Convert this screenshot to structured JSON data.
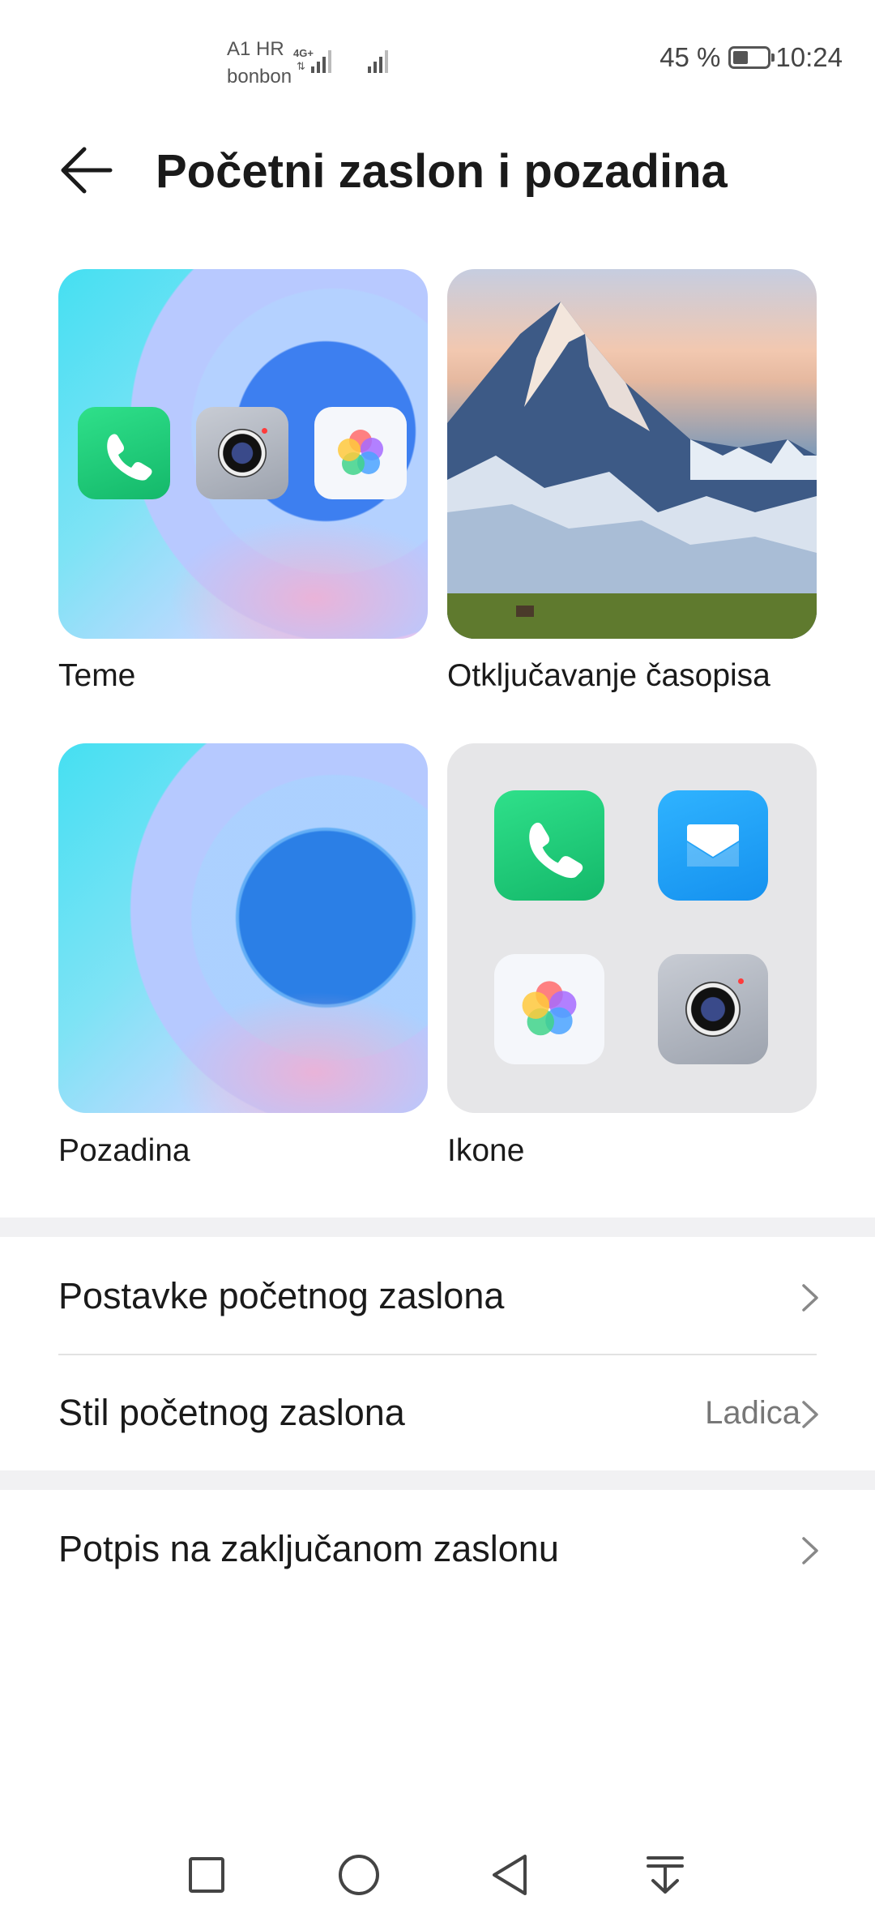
{
  "status_bar": {
    "carrier_line1": "A1 HR",
    "carrier_line2": "bonbon",
    "network": "4G+",
    "battery_percent": "45 %",
    "battery_level": 0.45,
    "time": "10:24"
  },
  "header": {
    "title": "Početni zaslon i pozadina"
  },
  "cards": {
    "themes_label": "Teme",
    "magazine_label": "Otključavanje časopisa",
    "wallpaper_label": "Pozadina",
    "icons_label": "Ikone"
  },
  "settings": {
    "home_settings_label": "Postavke početnog zaslona",
    "home_style_label": "Stil početnog zaslona",
    "home_style_value": "Ladica",
    "lock_signature_label": "Potpis na zaključanom zaslonu"
  },
  "colors": {
    "accent_phone": "#14b86a",
    "accent_mail": "#1591ef"
  }
}
